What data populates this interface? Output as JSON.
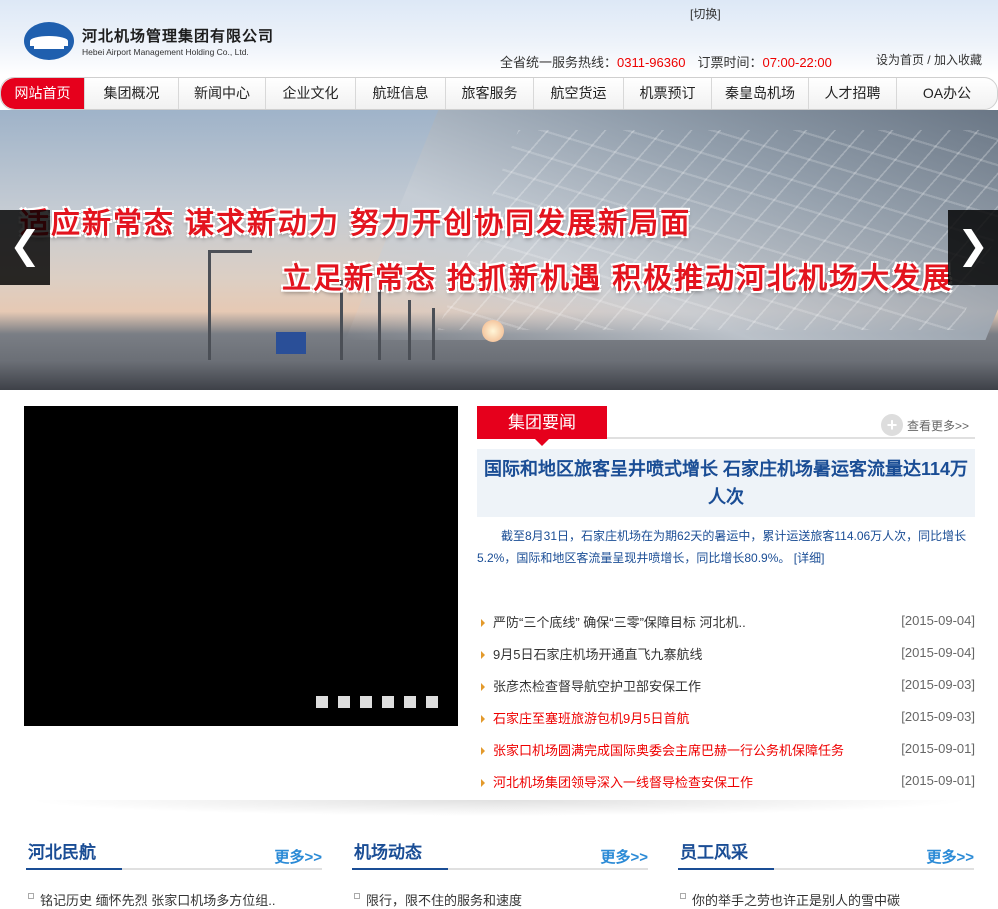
{
  "header": {
    "company_cn": "河北机场管理集团有限公司",
    "company_en": "Hebei Airport Management Holding Co., Ltd.",
    "switch_label": "[切换]",
    "hotline_label": "全省统一服务热线：",
    "hotline_number": "0311-96360",
    "booking_label": "订票时间：",
    "booking_time": "07:00-22:00",
    "set_home": "设为首页",
    "separator": " / ",
    "add_favorite": "加入收藏"
  },
  "nav": {
    "items": [
      {
        "label": "网站首页",
        "active": true
      },
      {
        "label": "集团概况"
      },
      {
        "label": "新闻中心"
      },
      {
        "label": "企业文化"
      },
      {
        "label": "航班信息"
      },
      {
        "label": "旅客服务"
      },
      {
        "label": "航空货运"
      },
      {
        "label": "机票预订"
      },
      {
        "label": "秦皇岛机场"
      },
      {
        "label": "人才招聘"
      },
      {
        "label": "OA办公"
      }
    ]
  },
  "banner": {
    "slogan_1": "适应新常态  谋求新动力  努力开创协同发展新局面",
    "slogan_2": "立足新常态  抢抓新机遇  积极推动河北机场大发展",
    "prev_icon": "chevron-left-icon",
    "next_icon": "chevron-right-icon"
  },
  "video": {
    "slide_count": 6
  },
  "news": {
    "tab_label": "集团要闻",
    "more_label": "查看更多>>",
    "headline": "国际和地区旅客呈井喷式增长 石家庄机场暑运客流量达114万人次",
    "summary": "截至8月31日，石家庄机场在为期62天的暑运中，累计运送旅客114.06万人次，同比增长5.2%，国际和地区客流量呈现井喷增长，同比增长80.9%。",
    "detail_label": "[详细]",
    "items": [
      {
        "title": "严防“三个底线” 确保“三零”保障目标 河北机..",
        "date": "[2015-09-04]",
        "red": false
      },
      {
        "title": "9月5日石家庄机场开通直飞九寨航线",
        "date": "[2015-09-04]",
        "red": false
      },
      {
        "title": "张彦杰检查督导航空护卫部安保工作",
        "date": "[2015-09-03]",
        "red": false
      },
      {
        "title": "石家庄至塞班旅游包机9月5日首航",
        "date": "[2015-09-03]",
        "red": true
      },
      {
        "title": "张家口机场圆满完成国际奥委会主席巴赫一行公务机保障任务",
        "date": "[2015-09-01]",
        "red": true
      },
      {
        "title": "河北机场集团领导深入一线督导检查安保工作",
        "date": "[2015-09-01]",
        "red": true
      }
    ]
  },
  "columns": [
    {
      "title": "河北民航",
      "more": "更多>>",
      "first_item": "铭记历史 缅怀先烈 张家口机场多方位组.."
    },
    {
      "title": "机场动态",
      "more": "更多>>",
      "first_item": "限行，限不住的服务和速度"
    },
    {
      "title": "员工风采",
      "more": "更多>>",
      "first_item": "你的举手之劳也许正是别人的雪中碳"
    }
  ],
  "colors": {
    "brand_red": "#e6001c",
    "brand_blue": "#1a4d95",
    "more_blue": "#2a8ad6"
  }
}
